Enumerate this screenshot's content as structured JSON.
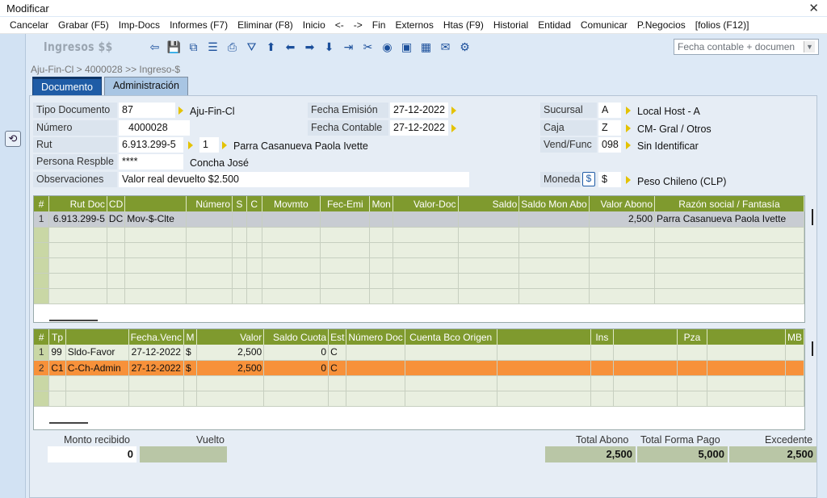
{
  "window": {
    "title": "Modificar",
    "close_glyph": "✕"
  },
  "menu": [
    "Cancelar",
    "Grabar (F5)",
    "Imp-Docs",
    "Informes (F7)",
    "Eliminar (F8)",
    "Inicio",
    "<-",
    "->",
    "Fin",
    "Externos",
    "Htas (F9)",
    "Historial",
    "Entidad",
    "Comunicar",
    "P.Negocios",
    "[folios (F12)]"
  ],
  "toolbar": {
    "app_title": "Ingresos $$",
    "icons": [
      "back-icon",
      "save-icon",
      "copy-icon",
      "print-list-icon",
      "printer-icon",
      "filter-icon",
      "up-icon",
      "left-icon",
      "right-icon",
      "down-icon",
      "end-icon",
      "tools-icon",
      "view-icon",
      "card-icon",
      "grid-icon",
      "chat-icon",
      "settings-icon"
    ],
    "view_select": "Fecha contable + documen"
  },
  "breadcrumb": "Aju-Fin-Cl > 4000028 >> Ingreso-$",
  "tabs": [
    "Documento",
    "Administración"
  ],
  "form": {
    "tipo_documento": {
      "label": "Tipo Documento",
      "value": "87",
      "desc": "Aju-Fin-Cl"
    },
    "numero": {
      "label": "Número",
      "value": "4000028"
    },
    "rut": {
      "label": "Rut",
      "value": "6.913.299-5",
      "branch": "1",
      "name": "Parra Casanueva Paola Ivette"
    },
    "persona": {
      "label": "Persona Respble",
      "value": "****",
      "name": "Concha José"
    },
    "observaciones": {
      "label": "Observaciones",
      "value": "Valor real devuelto $2.500"
    },
    "fecha_emision": {
      "label": "Fecha Emisión",
      "value": "27-12-2022"
    },
    "fecha_contable": {
      "label": "Fecha Contable",
      "value": "27-12-2022"
    },
    "sucursal": {
      "label": "Sucursal",
      "value": "A",
      "desc": "Local Host - A"
    },
    "caja": {
      "label": "Caja",
      "value": "Z",
      "desc": "CM- Gral / Otros"
    },
    "vend": {
      "label": "Vend/Func",
      "value": "098",
      "desc": "Sin Identificar"
    },
    "moneda": {
      "label": "Moneda",
      "icon": "$",
      "value": "$",
      "desc": "Peso Chileno (CLP)"
    }
  },
  "grid1": {
    "headers": [
      "#",
      "Rut Doc",
      "CD",
      "",
      "Número",
      "S",
      "C",
      "Movmto",
      "Fec-Emi",
      "Mon",
      "Valor-Doc",
      "Saldo",
      "Saldo Mon Abo",
      "Valor Abono",
      "Razón social / Fantasía"
    ],
    "rows": [
      [
        "1",
        "6.913.299-5",
        "DC",
        "Mov-$-Clte",
        "",
        "",
        "",
        "",
        "",
        "",
        "",
        "",
        "",
        "2,500",
        "Parra Casanueva Paola Ivette"
      ]
    ],
    "empty_rows": 5
  },
  "grid2": {
    "headers": [
      "#",
      "Tp",
      "",
      "Fecha.Venc",
      "M",
      "Valor",
      "Saldo Cuota",
      "Est",
      "Número Doc",
      "Cuenta Bco Origen",
      "",
      "Ins",
      "",
      "Pza",
      "",
      "MB"
    ],
    "rows": [
      [
        "1",
        "99",
        "Sldo-Favor",
        "27-12-2022",
        "$",
        "2,500",
        "0",
        "C",
        "",
        "",
        "",
        "",
        "",
        "",
        "",
        ""
      ],
      [
        "2",
        "C1",
        "C-Ch-Admin",
        "27-12-2022",
        "$",
        "2,500",
        "0",
        "C",
        "",
        "",
        "",
        "",
        "",
        "",
        "",
        ""
      ]
    ],
    "empty_rows": 2
  },
  "footer": {
    "monto_recibido": {
      "label": "Monto recibido",
      "value": "0"
    },
    "vuelto": {
      "label": "Vuelto",
      "value": ""
    },
    "total_abono": {
      "label": "Total Abono",
      "value": "2,500"
    },
    "total_forma_pago": {
      "label": "Total Forma Pago",
      "value": "5,000"
    },
    "excedente": {
      "label": "Excedente",
      "value": "2,500"
    }
  },
  "colors": {
    "grid_header": "#7f9a2e",
    "selected_row": "#f7913a",
    "tab_active": "#1f5ca6",
    "arrow": "#e4c200"
  }
}
